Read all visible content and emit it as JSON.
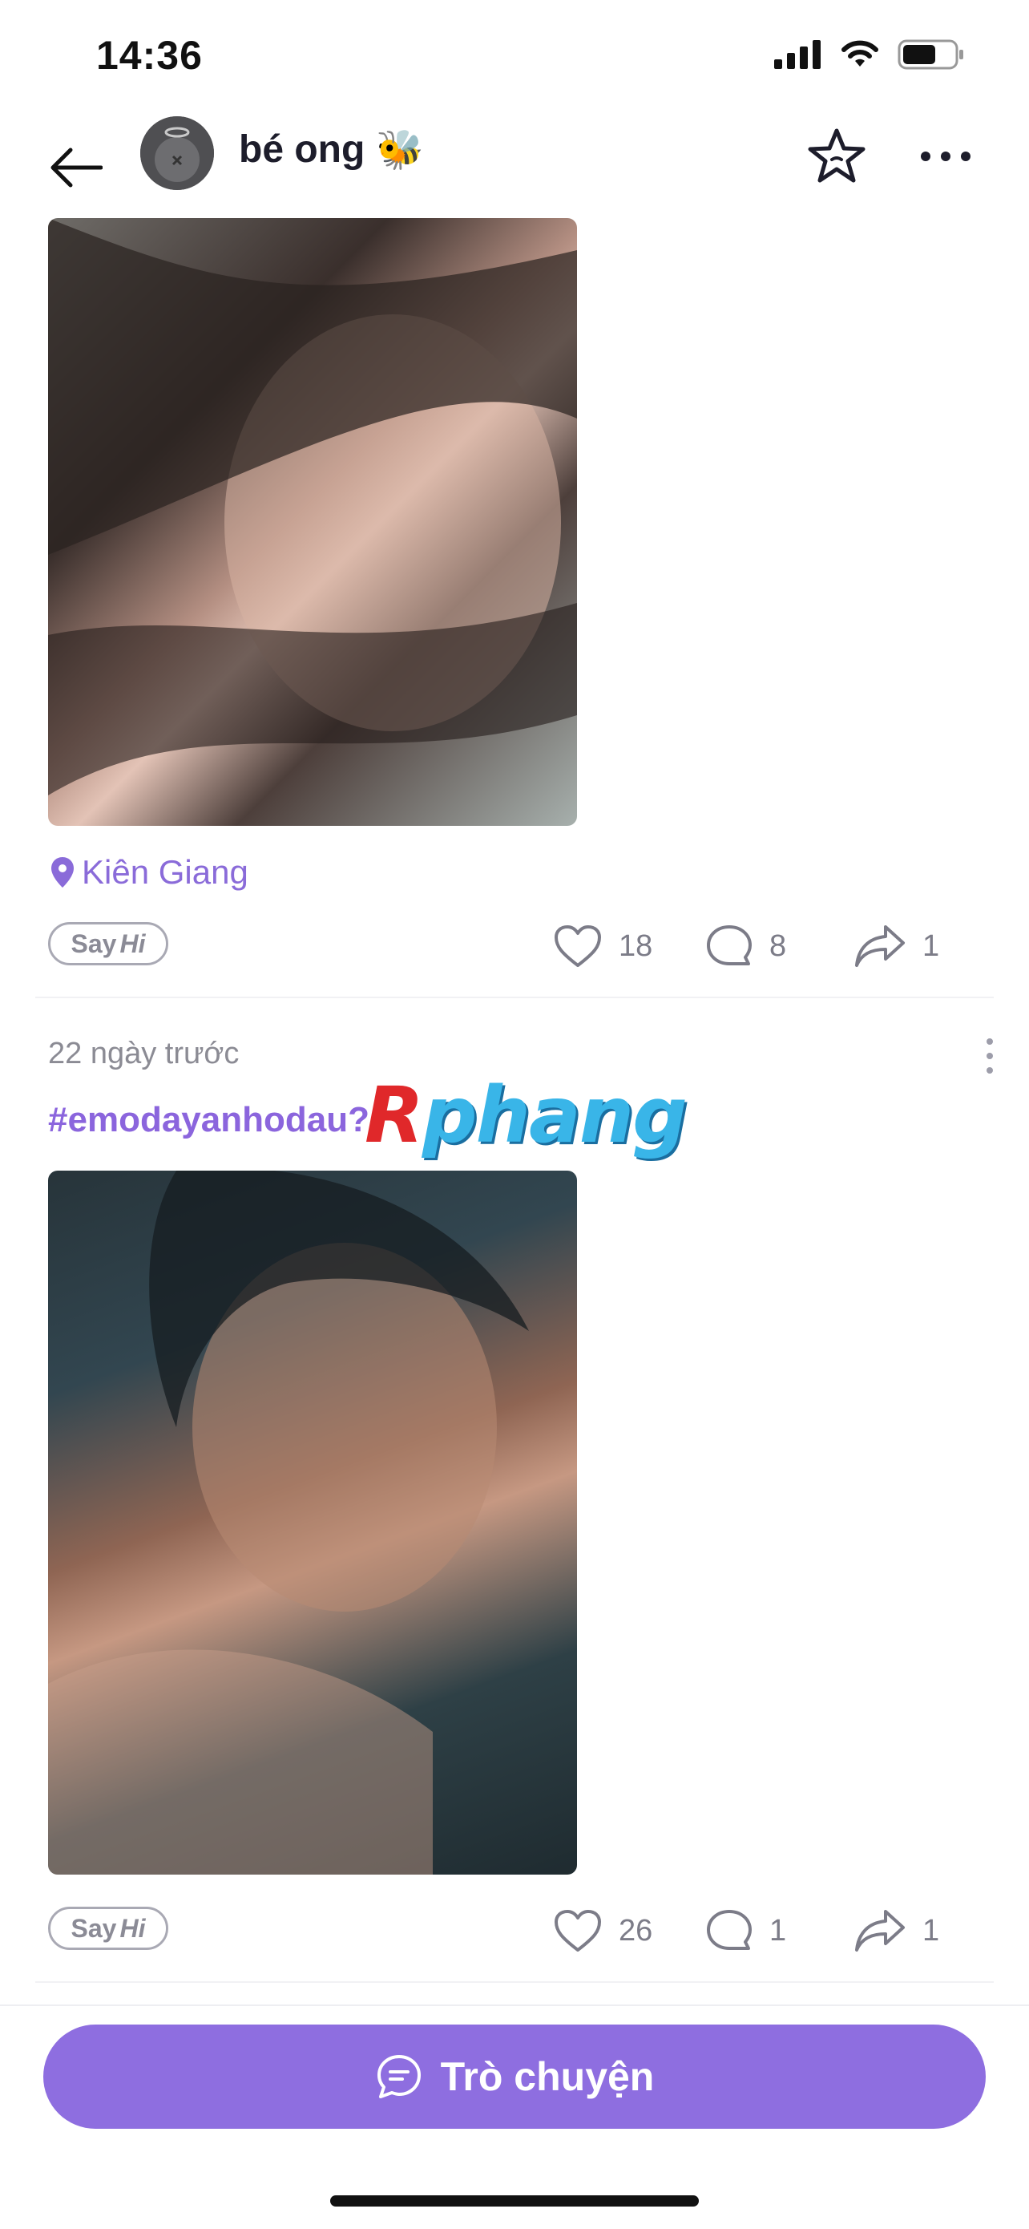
{
  "status_bar": {
    "time": "14:36"
  },
  "header": {
    "name": "bé ong",
    "emoji": "🐝"
  },
  "post1": {
    "location": "Kiên Giang",
    "sayhi_say": "Say",
    "sayhi_hi": "Hi",
    "likes": "18",
    "comments": "8",
    "shares": "1"
  },
  "post2": {
    "time": "22 ngày trước",
    "hashtag": "#emodayanhodau?",
    "sayhi_say": "Say",
    "sayhi_hi": "Hi",
    "likes": "26",
    "comments": "1",
    "shares": "1"
  },
  "watermark": {
    "first": "R",
    "rest": "phang"
  },
  "chat_button": {
    "label": "Trò chuyện"
  },
  "colors": {
    "accent": "#8e6ee0",
    "hashtag": "#8b65dd",
    "location": "#8a6bd9"
  }
}
